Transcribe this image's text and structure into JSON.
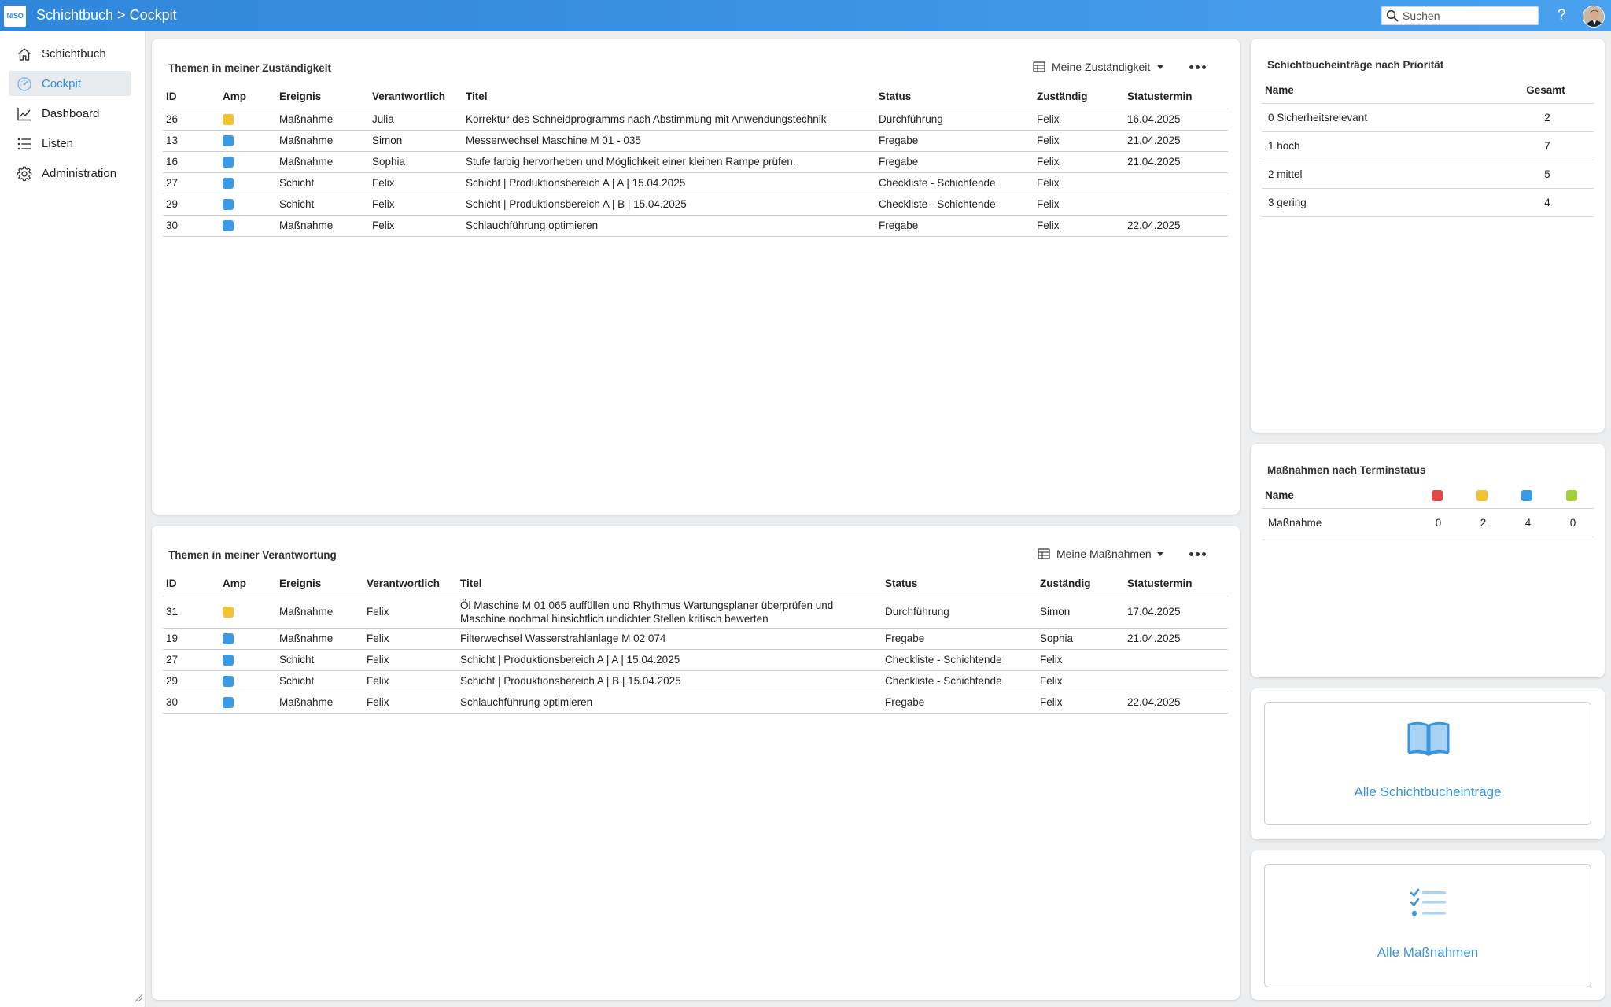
{
  "app": {
    "logo_text": "NISO",
    "title": "Schichtbuch > Cockpit",
    "search_placeholder": "Suchen",
    "help_label": "?"
  },
  "sidebar": {
    "items": [
      {
        "label": "Schichtbuch",
        "icon": "home-icon"
      },
      {
        "label": "Cockpit",
        "icon": "gauge-icon"
      },
      {
        "label": "Dashboard",
        "icon": "chart-line-icon"
      },
      {
        "label": "Listen",
        "icon": "list-icon"
      },
      {
        "label": "Administration",
        "icon": "gear-icon"
      }
    ],
    "active_index": 1
  },
  "colors": {
    "accent": "#3a95e0",
    "amp_yellow": "#f2c230",
    "amp_blue": "#3a9ae6",
    "amp_red": "#e34848",
    "amp_green": "#a4cf3a"
  },
  "panel_zustaendigkeit": {
    "title": "Themen in meiner Zuständigkeit",
    "view_label": "Meine Zuständigkeit",
    "columns": [
      "ID",
      "Amp",
      "Ereignis",
      "Verantwortlich",
      "Titel",
      "Status",
      "Zuständig",
      "Statustermin"
    ],
    "rows": [
      {
        "id": "26",
        "amp": "yellow",
        "ereignis": "Maßnahme",
        "verantwortlich": "Julia",
        "titel": "Korrektur des Schneidprogramms nach Abstimmung mit Anwendungstechnik",
        "status": "Durchführung",
        "zustaendig": "Felix",
        "termin": "16.04.2025"
      },
      {
        "id": "13",
        "amp": "blue",
        "ereignis": "Maßnahme",
        "verantwortlich": "Simon",
        "titel": "Messerwechsel Maschine M 01 - 035",
        "status": "Fregabe",
        "zustaendig": "Felix",
        "termin": "21.04.2025"
      },
      {
        "id": "16",
        "amp": "blue",
        "ereignis": "Maßnahme",
        "verantwortlich": "Sophia",
        "titel": "Stufe farbig hervorheben und Möglichkeit einer kleinen Rampe prüfen.",
        "status": "Fregabe",
        "zustaendig": "Felix",
        "termin": "21.04.2025"
      },
      {
        "id": "27",
        "amp": "blue",
        "ereignis": "Schicht",
        "verantwortlich": "Felix",
        "titel": "Schicht | Produktionsbereich A | A | 15.04.2025",
        "status": "Checkliste - Schichtende",
        "zustaendig": "Felix",
        "termin": ""
      },
      {
        "id": "29",
        "amp": "blue",
        "ereignis": "Schicht",
        "verantwortlich": "Felix",
        "titel": "Schicht | Produktionsbereich A | B | 15.04.2025",
        "status": "Checkliste - Schichtende",
        "zustaendig": "Felix",
        "termin": ""
      },
      {
        "id": "30",
        "amp": "blue",
        "ereignis": "Maßnahme",
        "verantwortlich": "Felix",
        "titel": "Schlauchführung optimieren",
        "status": "Fregabe",
        "zustaendig": "Felix",
        "termin": "22.04.2025"
      }
    ]
  },
  "panel_verantwortung": {
    "title": "Themen in meiner Verantwortung",
    "view_label": "Meine Maßnahmen",
    "columns": [
      "ID",
      "Amp",
      "Ereignis",
      "Verantwortlich",
      "Titel",
      "Status",
      "Zuständig",
      "Statustermin"
    ],
    "rows": [
      {
        "id": "31",
        "amp": "yellow",
        "ereignis": "Maßnahme",
        "verantwortlich": "Felix",
        "titel": "Öl Maschine M 01 065 auffüllen und Rhythmus Wartungsplaner überprüfen und Maschine nochmal hinsichtlich undichter Stellen kritisch bewerten",
        "status": "Durchführung",
        "zustaendig": "Simon",
        "termin": "17.04.2025"
      },
      {
        "id": "19",
        "amp": "blue",
        "ereignis": "Maßnahme",
        "verantwortlich": "Felix",
        "titel": "Filterwechsel Wasserstrahlanlage M 02 074",
        "status": "Fregabe",
        "zustaendig": "Sophia",
        "termin": "21.04.2025"
      },
      {
        "id": "27",
        "amp": "blue",
        "ereignis": "Schicht",
        "verantwortlich": "Felix",
        "titel": "Schicht | Produktionsbereich A | A | 15.04.2025",
        "status": "Checkliste - Schichtende",
        "zustaendig": "Felix",
        "termin": ""
      },
      {
        "id": "29",
        "amp": "blue",
        "ereignis": "Schicht",
        "verantwortlich": "Felix",
        "titel": "Schicht | Produktionsbereich A | B | 15.04.2025",
        "status": "Checkliste - Schichtende",
        "zustaendig": "Felix",
        "termin": ""
      },
      {
        "id": "30",
        "amp": "blue",
        "ereignis": "Maßnahme",
        "verantwortlich": "Felix",
        "titel": "Schlauchführung optimieren",
        "status": "Fregabe",
        "zustaendig": "Felix",
        "termin": "22.04.2025"
      }
    ]
  },
  "panel_prioritaet": {
    "title": "Schichtbucheinträge nach Priorität",
    "columns": [
      "Name",
      "Gesamt"
    ],
    "rows": [
      {
        "name": "0 Sicherheitsrelevant",
        "gesamt": "2"
      },
      {
        "name": "1 hoch",
        "gesamt": "7"
      },
      {
        "name": "2 mittel",
        "gesamt": "5"
      },
      {
        "name": "3 gering",
        "gesamt": "4"
      }
    ]
  },
  "panel_terminstatus": {
    "title": "Maßnahmen nach Terminstatus",
    "name_header": "Name",
    "status_colors": [
      "red",
      "yellow",
      "blue",
      "green"
    ],
    "rows": [
      {
        "name": "Maßnahme",
        "red": "0",
        "yellow": "2",
        "blue": "4",
        "green": "0"
      }
    ]
  },
  "tiles": {
    "eintraege_label": "Alle Schichtbucheinträge",
    "eintraege_icon": "open-book-icon",
    "massnahmen_label": "Alle Maßnahmen",
    "massnahmen_icon": "checklist-icon"
  }
}
